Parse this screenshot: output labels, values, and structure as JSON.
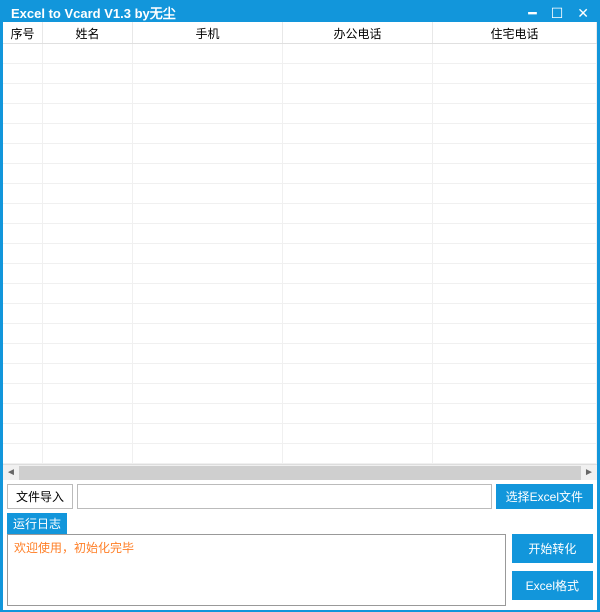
{
  "titlebar": {
    "title": "Excel to Vcard V1.3     by无尘"
  },
  "grid": {
    "columns": [
      "序号",
      "姓名",
      "手机",
      "办公电话",
      "住宅电话"
    ],
    "rowCount": 21
  },
  "fileImport": {
    "label": "文件导入",
    "value": "",
    "selectButton": "选择Excel文件"
  },
  "log": {
    "label": "运行日志",
    "content": "欢迎使用，初始化完毕"
  },
  "actions": {
    "startConvert": "开始转化",
    "excelFormat": "Excel格式"
  }
}
